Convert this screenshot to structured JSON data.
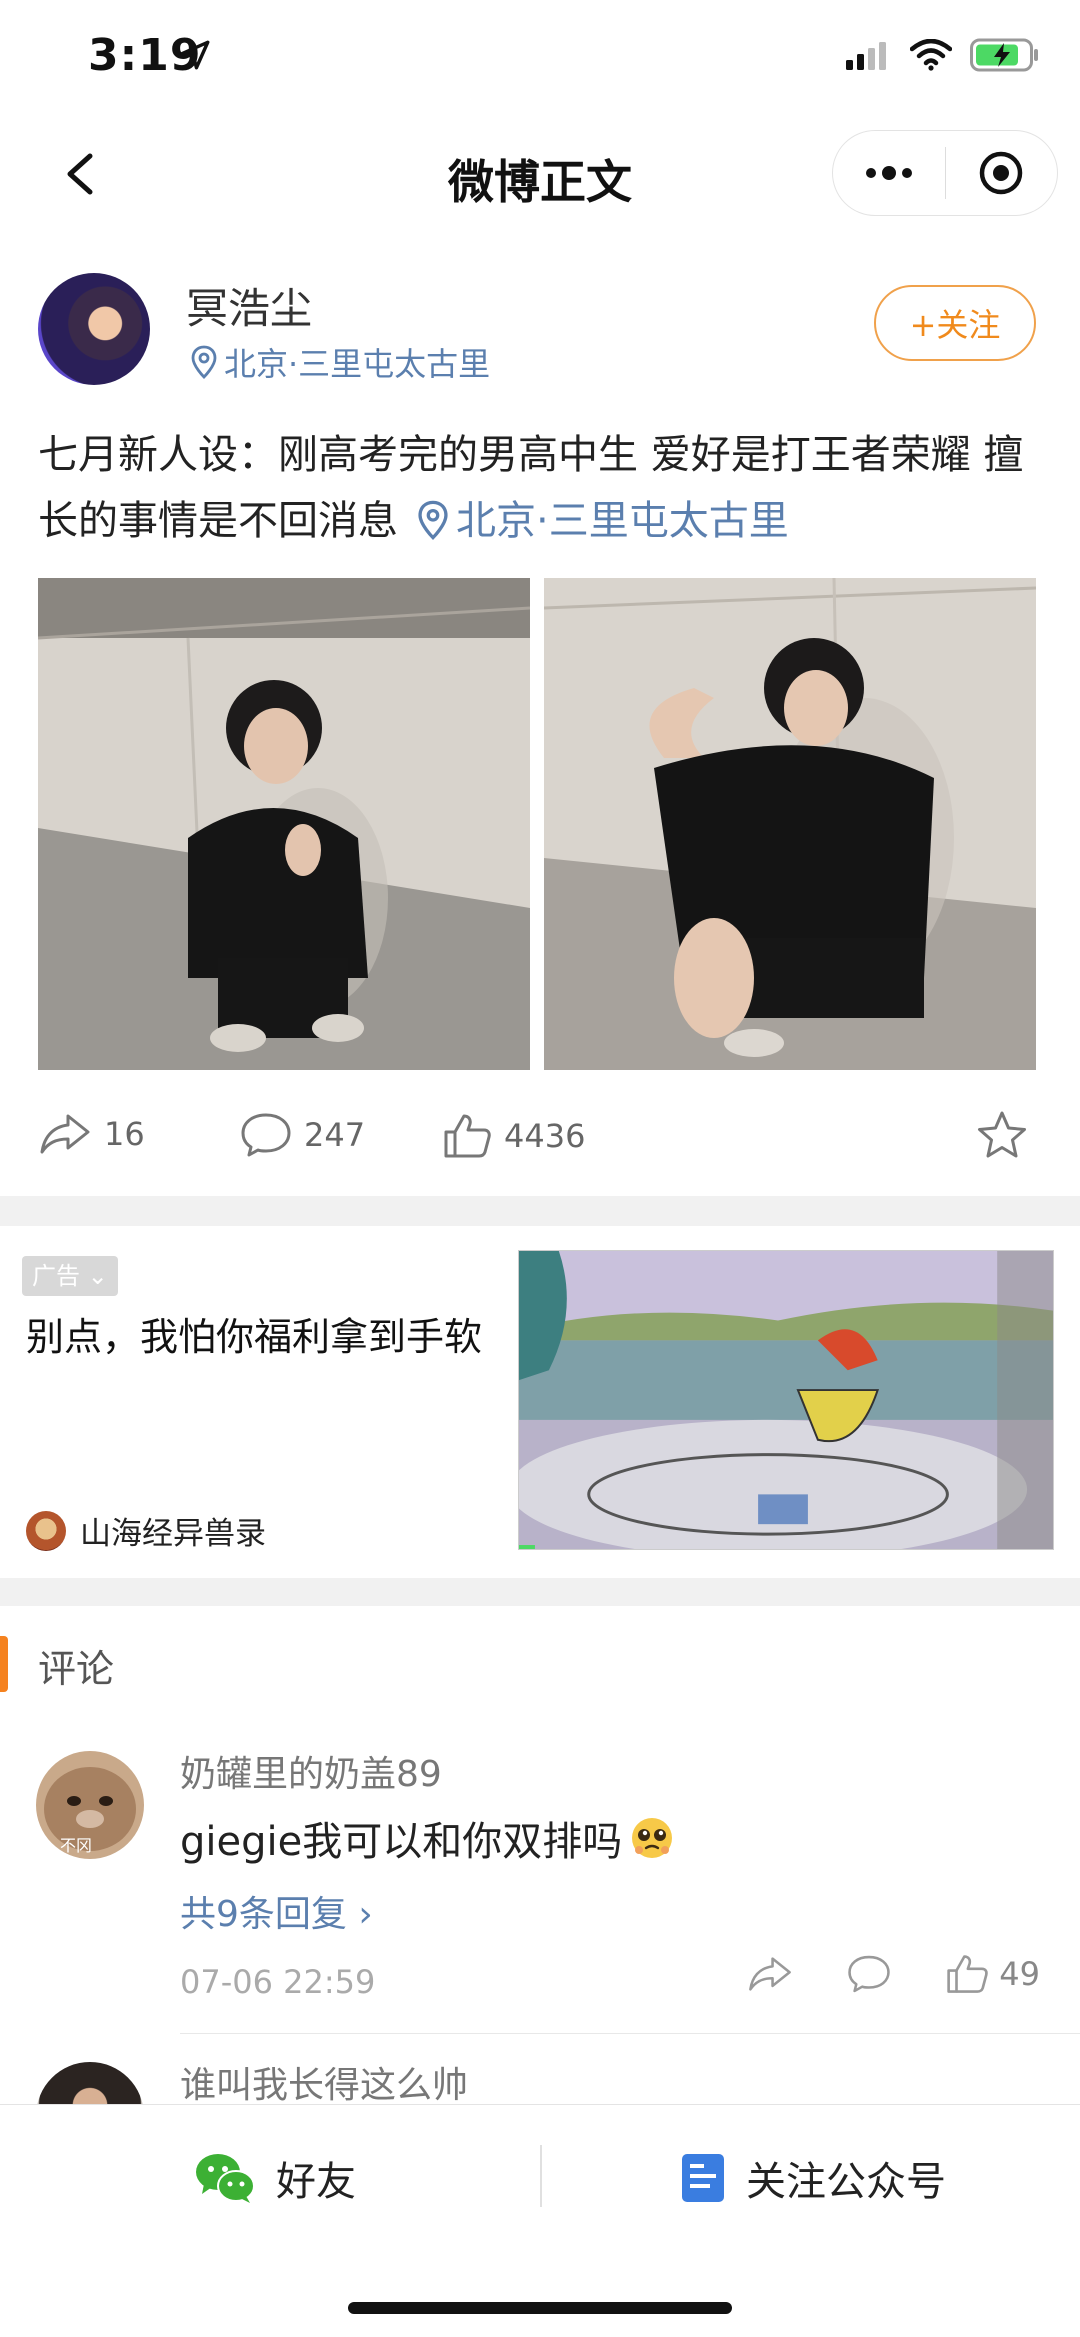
{
  "status_bar": {
    "time": "3:19"
  },
  "nav": {
    "title": "微博正文"
  },
  "post": {
    "user_name": "冥浩尘",
    "location": "北京·三里屯太古里",
    "follow_label": "+关注",
    "text": "七月新人设：刚高考完的男高中生 爱好是打王者荣耀 擅长的事情是不回消息",
    "text_location": "北京·三里屯太古里",
    "shares": "16",
    "comments": "247",
    "likes": "4436"
  },
  "ad": {
    "tag": "广告",
    "title": "别点，我怕你福利拿到手软",
    "brand": "山海经异兽录"
  },
  "comments": {
    "header": "评论",
    "items": [
      {
        "user": "奶罐里的奶盖89",
        "text": "giegie我可以和你双排吗",
        "replies": "共9条回复 ›",
        "time": "07-06 22:59",
        "likes": "49",
        "avatar_caption": "不冈"
      },
      {
        "user": "谁叫我长得这么帅"
      }
    ]
  },
  "bottom_bar": {
    "friends_label": "好友",
    "follow_account_label": "关注公众号"
  },
  "colors": {
    "link_blue": "#5b7fae",
    "accent_orange": "#f5821f",
    "follow_orange": "#f0a14b"
  },
  "icons": {
    "share": "share-arrow-icon",
    "comment": "comment-bubble-icon",
    "like": "thumbs-up-icon",
    "favorite": "star-icon",
    "location": "location-pin-icon",
    "wechat": "wechat-icon",
    "official_account": "document-icon"
  }
}
